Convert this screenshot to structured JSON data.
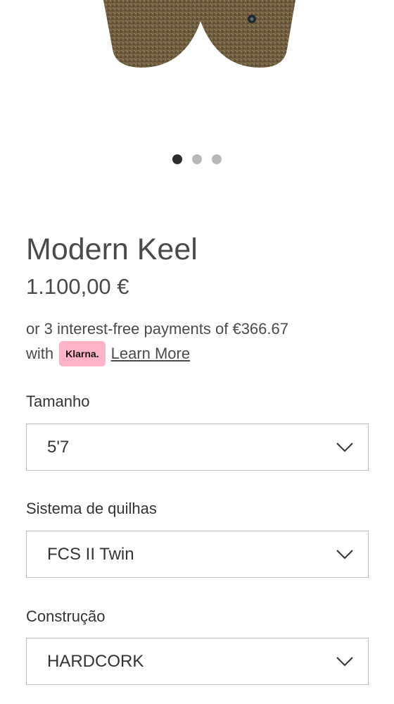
{
  "gallery": {
    "slides": 3,
    "active_index": 0
  },
  "product": {
    "title": "Modern Keel",
    "price": "1.100,00 €"
  },
  "klarna": {
    "text_before": "or 3 interest-free payments of €366.67",
    "with": "with",
    "badge": "Klarna.",
    "learn_more": "Learn More",
    "badge_color": "#ffb3c7"
  },
  "options": {
    "size": {
      "label": "Tamanho",
      "value": "5'7"
    },
    "fins": {
      "label": "Sistema de quilhas",
      "value": "FCS II Twin"
    },
    "construction": {
      "label": "Construção",
      "value": "HARDCORK"
    }
  },
  "icons": {
    "dropdown": "chevron-down-icon"
  }
}
